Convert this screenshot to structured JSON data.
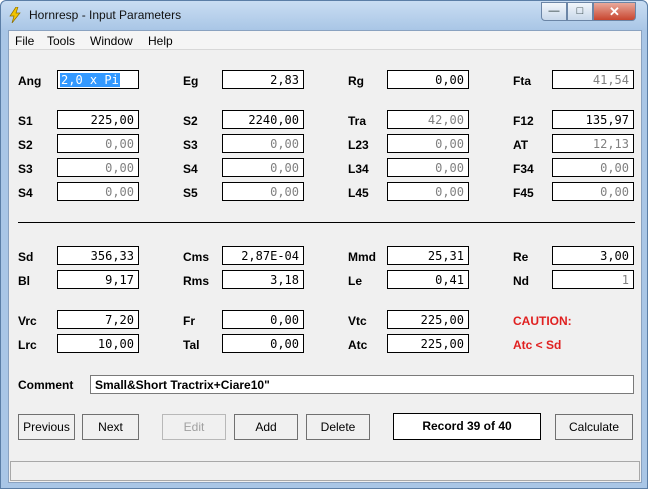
{
  "window": {
    "title": "Hornresp - Input Parameters",
    "app_icon": "lightning-icon",
    "minimize_glyph": "—",
    "maximize_glyph": "□",
    "close_glyph": "✕"
  },
  "menu": [
    "File",
    "Tools",
    "Window",
    "Help"
  ],
  "fields": {
    "ang": {
      "label": "Ang",
      "value": "2,0 x Pi"
    },
    "eg": {
      "label": "Eg",
      "value": "2,83"
    },
    "rg": {
      "label": "Rg",
      "value": "0,00"
    },
    "fta": {
      "label": "Fta",
      "value": "41,54"
    },
    "s1": {
      "label": "S1",
      "value": "225,00"
    },
    "s2b": {
      "label": "S2",
      "value": "2240,00"
    },
    "tra": {
      "label": "Tra",
      "value": "42,00"
    },
    "f12": {
      "label": "F12",
      "value": "135,97"
    },
    "s2": {
      "label": "S2",
      "value": "0,00"
    },
    "s3b": {
      "label": "S3",
      "value": "0,00"
    },
    "l23": {
      "label": "L23",
      "value": "0,00"
    },
    "at": {
      "label": "AT",
      "value": "12,13"
    },
    "s3": {
      "label": "S3",
      "value": "0,00"
    },
    "s4b": {
      "label": "S4",
      "value": "0,00"
    },
    "l34": {
      "label": "L34",
      "value": "0,00"
    },
    "f34": {
      "label": "F34",
      "value": "0,00"
    },
    "s4": {
      "label": "S4",
      "value": "0,00"
    },
    "s5": {
      "label": "S5",
      "value": "0,00"
    },
    "l45": {
      "label": "L45",
      "value": "0,00"
    },
    "f45": {
      "label": "F45",
      "value": "0,00"
    },
    "sd": {
      "label": "Sd",
      "value": "356,33"
    },
    "cms": {
      "label": "Cms",
      "value": "2,87E-04"
    },
    "mmd": {
      "label": "Mmd",
      "value": "25,31"
    },
    "re": {
      "label": "Re",
      "value": "3,00"
    },
    "bl": {
      "label": "Bl",
      "value": "9,17"
    },
    "rms": {
      "label": "Rms",
      "value": "3,18"
    },
    "le": {
      "label": "Le",
      "value": "0,41"
    },
    "nd": {
      "label": "Nd",
      "value": "1"
    },
    "vrc": {
      "label": "Vrc",
      "value": "7,20"
    },
    "fr": {
      "label": "Fr",
      "value": "0,00"
    },
    "vtc": {
      "label": "Vtc",
      "value": "225,00"
    },
    "lrc": {
      "label": "Lrc",
      "value": "10,00"
    },
    "tal": {
      "label": "Tal",
      "value": "0,00"
    },
    "atc": {
      "label": "Atc",
      "value": "225,00"
    }
  },
  "caution": {
    "title": "CAUTION:",
    "message": "Atc < Sd",
    "color": "#e02020"
  },
  "comment": {
    "label": "Comment",
    "value": "Small&Short Tractrix+Ciare10\""
  },
  "buttons": {
    "previous": "Previous",
    "next": "Next",
    "edit": "Edit",
    "add": "Add",
    "delete": "Delete",
    "calculate": "Calculate"
  },
  "record": "Record 39 of 40",
  "colors": {
    "selection": "#3399ff",
    "readonly_text": "#808080"
  }
}
